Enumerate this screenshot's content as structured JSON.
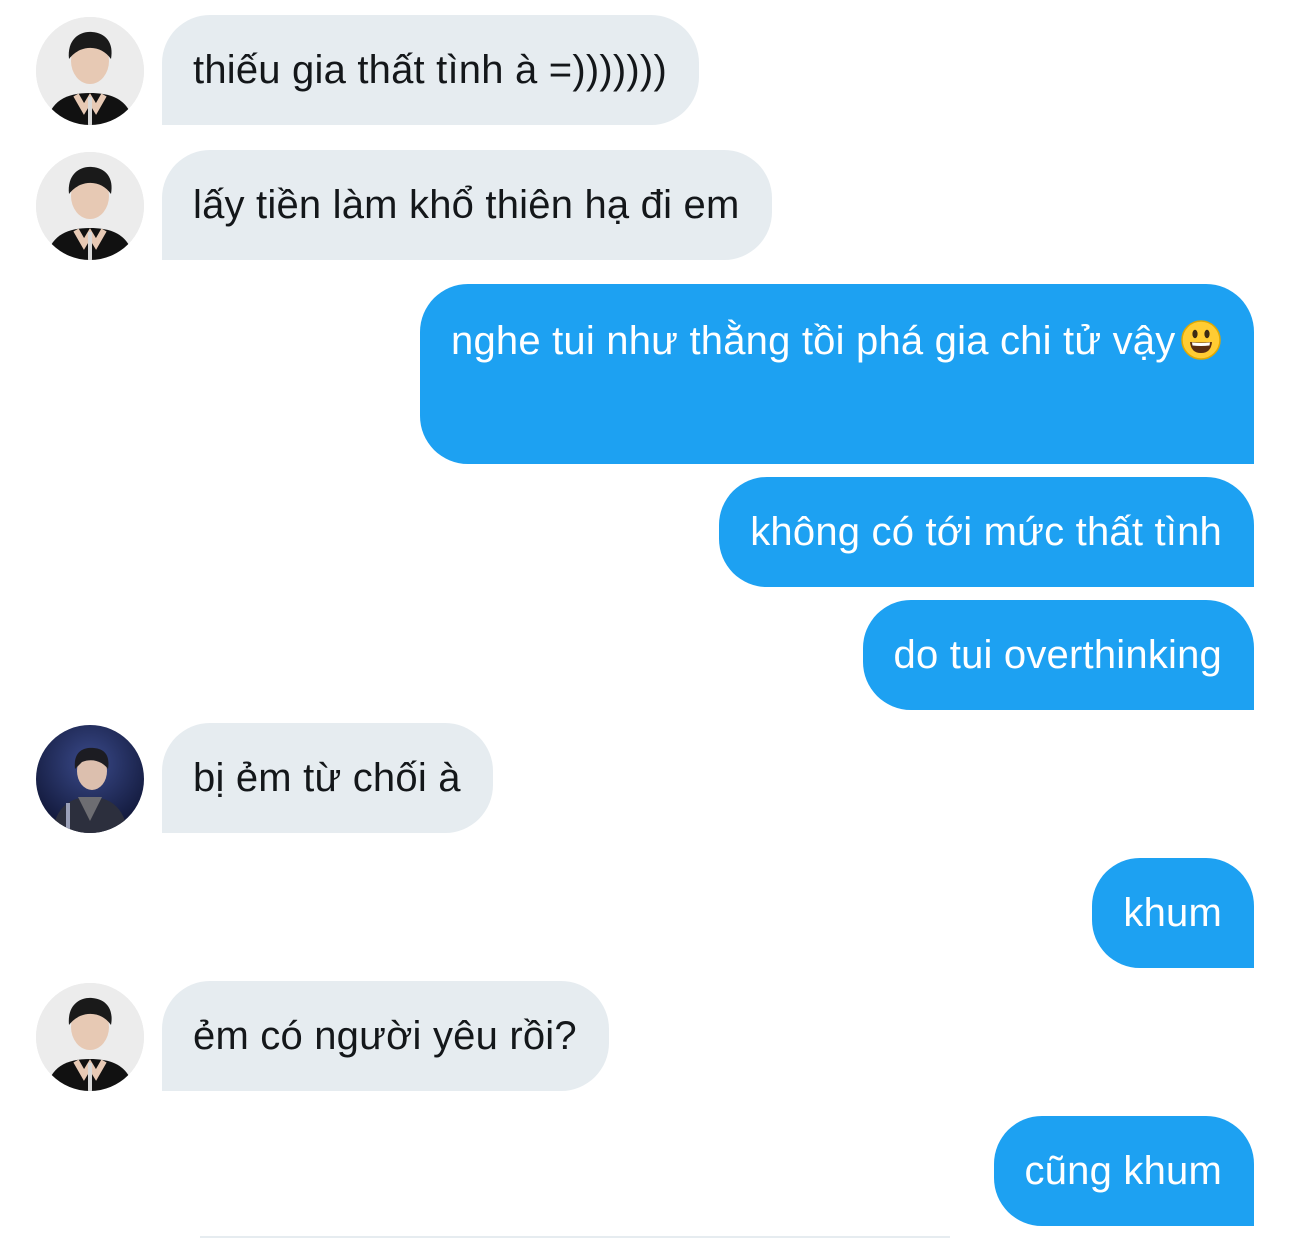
{
  "conversation": {
    "messages": [
      {
        "direction": "received",
        "avatar": "avatar-a",
        "text": "thiếu gia thất tình à =)))))))"
      },
      {
        "direction": "received",
        "avatar": "avatar-a",
        "text": "lấy tiền làm khổ thiên hạ đi em"
      },
      {
        "direction": "sent",
        "text": "nghe tui như thằng tồi phá gia chi tử vậy",
        "emoji": "grinning-face-emoji"
      },
      {
        "direction": "sent",
        "text": "không có tới mức thất tình"
      },
      {
        "direction": "sent",
        "text": "do tui overthinking"
      },
      {
        "direction": "received",
        "avatar": "avatar-b",
        "text": "bị ẻm từ chối à"
      },
      {
        "direction": "sent",
        "text": "khum"
      },
      {
        "direction": "received",
        "avatar": "avatar-a",
        "text": "ẻm có người yêu rồi?"
      },
      {
        "direction": "sent",
        "text": "cũng khum"
      }
    ]
  },
  "colors": {
    "sent_bubble": "#1da1f2",
    "received_bubble": "#e6ecf0",
    "received_text": "#14171a",
    "sent_text": "#ffffff"
  }
}
